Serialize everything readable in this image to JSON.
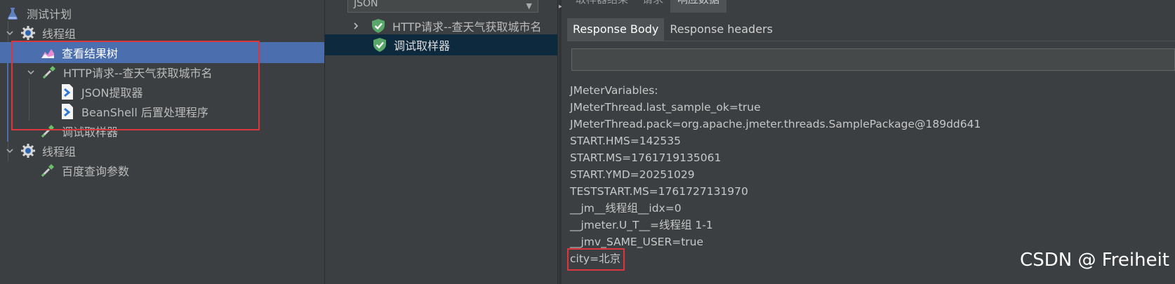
{
  "tree": {
    "items": [
      {
        "label": "测试计划",
        "icon": "flask-icon"
      },
      {
        "label": "线程组",
        "icon": "gear-icon"
      },
      {
        "label": "查看结果树",
        "icon": "chart-icon"
      },
      {
        "label": "HTTP请求--查天气获取城市名",
        "icon": "pipette-icon"
      },
      {
        "label": "JSON提取器",
        "icon": "extractor-icon"
      },
      {
        "label": "BeanShell 后置处理程序",
        "icon": "extractor-icon"
      },
      {
        "label": "调试取样器",
        "icon": "pipette-icon"
      },
      {
        "label": "线程组",
        "icon": "gear-icon"
      },
      {
        "label": "百度查询参数",
        "icon": "pipette-icon"
      }
    ]
  },
  "results": {
    "combo_value": "JSON",
    "rows": [
      {
        "label": "HTTP请求--查天气获取城市名",
        "icon": "success-shield-icon"
      },
      {
        "label": "调试取样器",
        "icon": "success-shield-icon"
      }
    ]
  },
  "detail": {
    "top_tabs": [
      "取样器结果",
      "请求",
      "响应数据"
    ],
    "sub_tabs": [
      "Response Body",
      "Response headers"
    ],
    "search_value": "",
    "lines": [
      "JMeterVariables:",
      "JMeterThread.last_sample_ok=true",
      "JMeterThread.pack=org.apache.jmeter.threads.SamplePackage@189dd641",
      "START.HMS=142535",
      "START.MS=1761719135061",
      "START.YMD=20251029",
      "TESTSTART.MS=1761727131970",
      "__jm__线程组__idx=0",
      "__jmeter.U_T__=线程组 1-1",
      "__jmv_SAME_USER=true",
      "city=北京"
    ]
  },
  "watermark": "CSDN @ Freiheit",
  "colors": {
    "background": "#3c3f41",
    "selection": "#4b6eaf",
    "result_selection": "#0d293e",
    "annotation_red": "#d9363e",
    "success_green": "#59a869"
  }
}
